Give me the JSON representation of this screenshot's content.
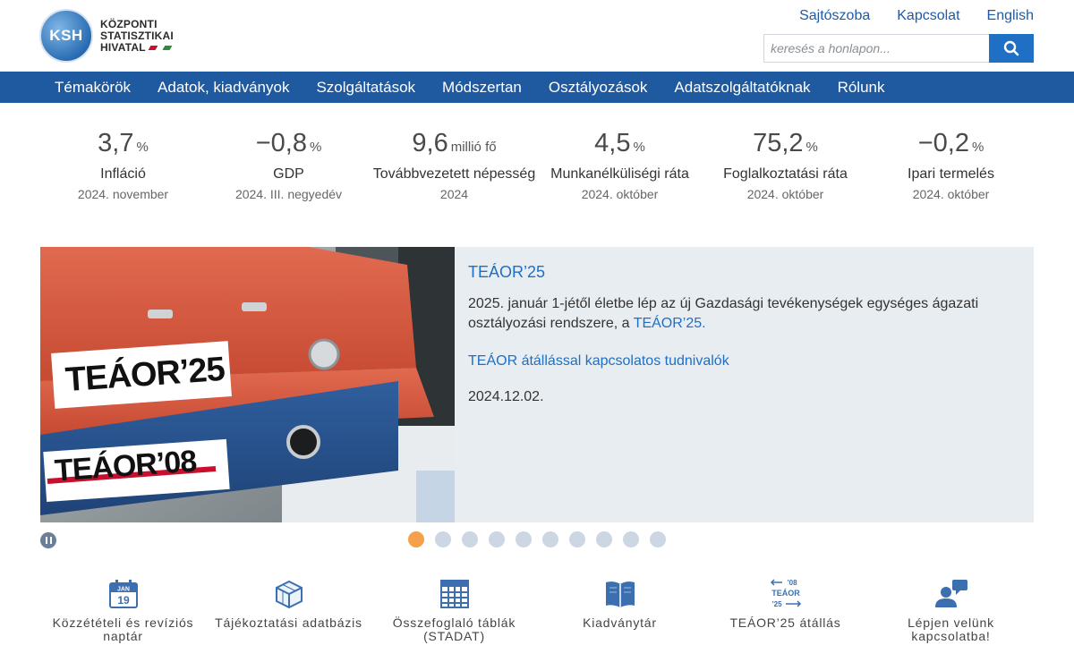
{
  "logo": {
    "abbr": "KSH",
    "line1": "KÖZPONTI",
    "line2": "STATISZTIKAI",
    "line3": "HIVATAL"
  },
  "toplinks": [
    "Sajtószoba",
    "Kapcsolat",
    "English"
  ],
  "search": {
    "placeholder": "keresés a honlapon..."
  },
  "nav": [
    "Témakörök",
    "Adatok, kiadványok",
    "Szolgáltatások",
    "Módszertan",
    "Osztályozások",
    "Adatszolgáltatóknak",
    "Rólunk"
  ],
  "stats": [
    {
      "value": "3,7",
      "unit": "%",
      "name": "Infláció",
      "period": "2024. november"
    },
    {
      "value": "−0,8",
      "unit": "%",
      "name": "GDP",
      "period": "2024. III. negyedév"
    },
    {
      "value": "9,6",
      "unit": "millió fő",
      "name": "Továbbvezetett népesség",
      "period": "2024"
    },
    {
      "value": "4,5",
      "unit": "%",
      "name": "Munkanélküliségi ráta",
      "period": "2024. október"
    },
    {
      "value": "75,2",
      "unit": "%",
      "name": "Foglalkoztatási ráta",
      "period": "2024. október"
    },
    {
      "value": "−0,2",
      "unit": "%",
      "name": "Ipari termelés",
      "period": "2024. október"
    }
  ],
  "slide": {
    "image_label_top": "TEÁOR’25",
    "image_label_bottom": "TEÁOR’08",
    "title": "TEÁOR’25",
    "body": "2025. január 1-jétől életbe lép az új Gazdasági tevékenységek egységes ágazati osztályozási rendszere, a ",
    "body_link": "TEÁOR’25.",
    "link": "TEÁOR átállással kapcsolatos tudnivalók",
    "date": "2024.12.02."
  },
  "slider": {
    "dot_count": 10,
    "active_index": 0
  },
  "quick": [
    {
      "label": "Közzétételi és revíziós naptár",
      "icon": "calendar-icon",
      "cal_month": "JAN",
      "cal_day": "19"
    },
    {
      "label": "Tájékoztatási adatbázis",
      "icon": "cube-icon"
    },
    {
      "label": "Összefoglaló táblák (STADAT)",
      "icon": "table-icon"
    },
    {
      "label": "Kiadványtár",
      "icon": "book-icon"
    },
    {
      "label": "TEÁOR’25 átállás",
      "icon": "teaor-icon",
      "icon_text": [
        "’08",
        "TEÁOR",
        "’25"
      ]
    },
    {
      "label": "Lépjen velünk kapcsolatba!",
      "icon": "contact-icon"
    }
  ],
  "colors": {
    "brand_blue": "#1f59a0",
    "link_blue": "#1f6fc4",
    "accent_orange": "#f5a04a"
  }
}
